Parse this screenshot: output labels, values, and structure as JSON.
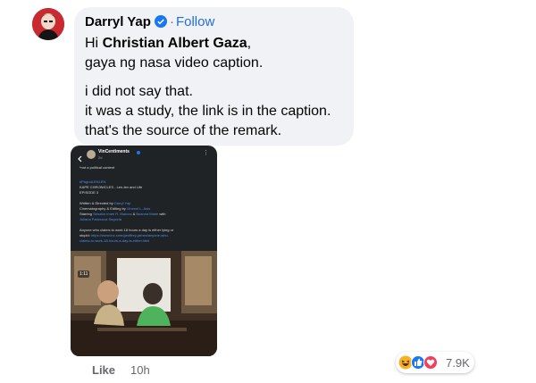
{
  "comment": {
    "author": "Darryl Yap",
    "follow_label": "Follow",
    "greeting": "Hi ",
    "mention": "Christian Albert Gaza",
    "greeting_end": ",",
    "line2": "gaya ng nasa video caption.",
    "para2_line1": "i did not say that.",
    "para2_line2": "it was a study, the link is in the caption.",
    "para2_line3": "that's the source of the remark."
  },
  "attachment": {
    "account": "VinCentiments",
    "time": "2d",
    "line1": "*not a political content",
    "hashtag": "#PagodLENLEN",
    "series": "KAPE CHRONICLES - Len-len and Life",
    "episode": "EPISODE 3",
    "written_prefix": "Written & Directed by ",
    "written_name": "Darryl Yap",
    "cinema_prefix": "Cinematography & Editing by ",
    "cinema_name": "Vincent L. Asis",
    "starring_prefix": "Starring ",
    "starring_name1": "Senator Imee R. Marcos",
    "starring_amp": " & ",
    "starring_name2": "Buanna Marie",
    "starring_with": " with",
    "starring_line2": "Juliana Parizcova Segovia",
    "quote_line1": "Anyone who claims to work 18 hours a day is either lying or",
    "quote_line2_prefix": "stupid: ",
    "quote_line2_link": "https://www.inc.com/geoffrey-james/anyone-who-",
    "quote_line3": "claims-to-work-18-hours-a-day-is-either.html",
    "video_badge": "1:11"
  },
  "actions": {
    "like_label": "Like",
    "time": "10h"
  },
  "reactions": {
    "count": "7.9K",
    "icons": [
      "haha-icon",
      "like-icon",
      "love-icon"
    ]
  },
  "colors": {
    "bubble": "#f0f2f5",
    "follow": "#216fdb",
    "verified": "#1877f2",
    "meta": "#65676b",
    "like_reaction": "#1877f2",
    "love_reaction": "#f33e58",
    "haha_reaction": "#f7b125"
  }
}
